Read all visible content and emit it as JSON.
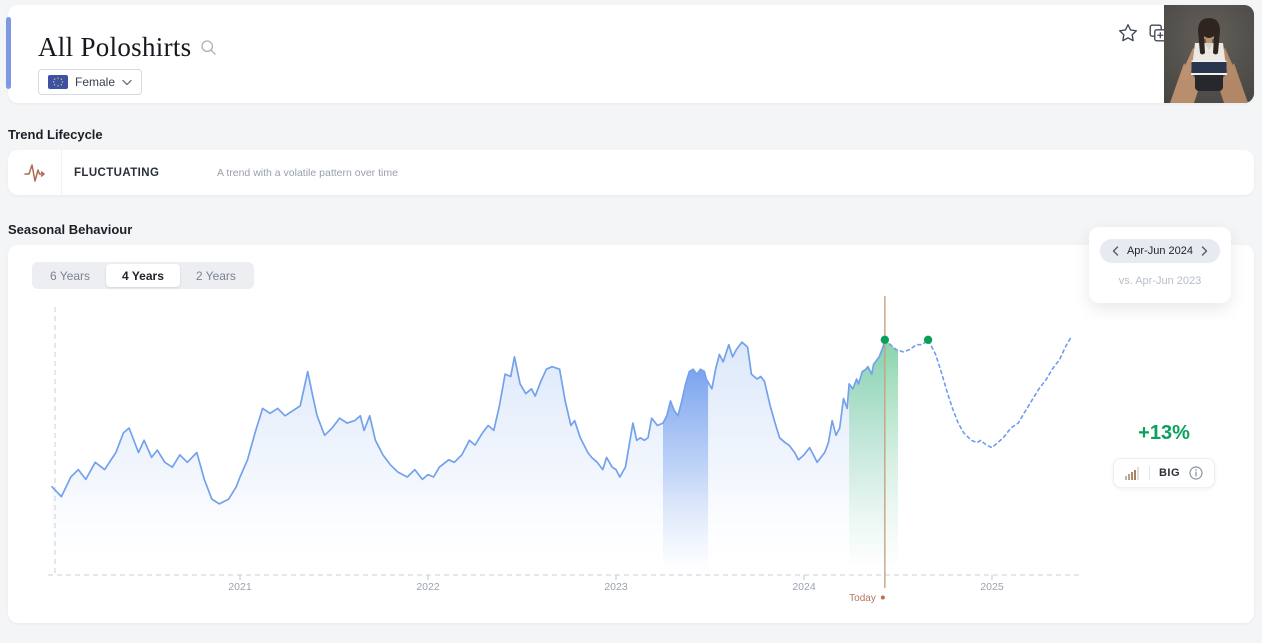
{
  "header": {
    "title": "All Poloshirts",
    "filter": {
      "label": "Female",
      "flag": "eu-flag"
    },
    "icons": {
      "search": "search-icon",
      "favorite": "star-icon",
      "duplicate": "copy-plus-icon"
    }
  },
  "trend_lifecycle": {
    "section_title": "Trend Lifecycle",
    "status": "FLUCTUATING",
    "description": "A trend with a volatile pattern over time",
    "icon": "pulse-icon",
    "icon_color": "#ab6c52"
  },
  "seasonal": {
    "section_title": "Seasonal Behaviour",
    "tabs": [
      {
        "label": "6 Years",
        "selected": false
      },
      {
        "label": "4 Years",
        "selected": true
      },
      {
        "label": "2 Years",
        "selected": false
      }
    ],
    "period_nav": {
      "current": "Apr-Jun 2024",
      "compare": "vs. Apr-Jun 2023"
    },
    "growth": {
      "value": "+13%",
      "magnitude": "BIG",
      "color": "#09a15c",
      "icons": [
        "bar-chart-icon",
        "info-icon"
      ]
    }
  },
  "chart_data": {
    "type": "area",
    "title": "Seasonal Behaviour",
    "xlabel": "",
    "ylabel": "",
    "grid": false,
    "x_axis": {
      "ticks": [
        "2021",
        "2022",
        "2023",
        "2024",
        "2025"
      ],
      "range": [
        2020.0,
        2025.5
      ]
    },
    "ylim": [
      0,
      110
    ],
    "today": {
      "t": 2024.43,
      "label": "Today"
    },
    "highlight_periods": [
      {
        "name": "Apr-Jun 2023",
        "start": 2023.25,
        "end": 2023.49,
        "color": "blue"
      },
      {
        "name": "Apr-Jun 2024",
        "start": 2024.24,
        "end": 2024.5,
        "color": "green"
      }
    ],
    "series": [
      {
        "name": "observed",
        "style": "solid",
        "points": [
          [
            2020.0,
            36
          ],
          [
            2020.05,
            32
          ],
          [
            2020.1,
            40
          ],
          [
            2020.14,
            43
          ],
          [
            2020.18,
            39
          ],
          [
            2020.23,
            46
          ],
          [
            2020.28,
            43
          ],
          [
            2020.34,
            50
          ],
          [
            2020.38,
            58
          ],
          [
            2020.41,
            60
          ],
          [
            2020.46,
            50
          ],
          [
            2020.49,
            55
          ],
          [
            2020.53,
            48
          ],
          [
            2020.56,
            51
          ],
          [
            2020.6,
            46
          ],
          [
            2020.64,
            44
          ],
          [
            2020.68,
            49
          ],
          [
            2020.72,
            46
          ],
          [
            2020.77,
            50
          ],
          [
            2020.81,
            39
          ],
          [
            2020.85,
            31
          ],
          [
            2020.89,
            29
          ],
          [
            2020.94,
            31
          ],
          [
            2020.98,
            36
          ],
          [
            2021.0,
            40
          ],
          [
            2021.04,
            47
          ],
          [
            2021.08,
            58
          ],
          [
            2021.12,
            68
          ],
          [
            2021.16,
            66
          ],
          [
            2021.2,
            68
          ],
          [
            2021.24,
            65
          ],
          [
            2021.28,
            67
          ],
          [
            2021.32,
            69
          ],
          [
            2021.36,
            83
          ],
          [
            2021.39,
            72
          ],
          [
            2021.41,
            65
          ],
          [
            2021.45,
            57
          ],
          [
            2021.49,
            60
          ],
          [
            2021.53,
            64
          ],
          [
            2021.57,
            62
          ],
          [
            2021.61,
            63
          ],
          [
            2021.64,
            65
          ],
          [
            2021.66,
            59
          ],
          [
            2021.69,
            65
          ],
          [
            2021.72,
            55
          ],
          [
            2021.76,
            49
          ],
          [
            2021.8,
            45
          ],
          [
            2021.84,
            42
          ],
          [
            2021.89,
            40
          ],
          [
            2021.93,
            43
          ],
          [
            2021.97,
            39
          ],
          [
            2022.0,
            41
          ],
          [
            2022.03,
            40
          ],
          [
            2022.06,
            44
          ],
          [
            2022.11,
            47
          ],
          [
            2022.14,
            46
          ],
          [
            2022.18,
            49
          ],
          [
            2022.22,
            55
          ],
          [
            2022.25,
            53
          ],
          [
            2022.29,
            58
          ],
          [
            2022.32,
            61
          ],
          [
            2022.35,
            59
          ],
          [
            2022.38,
            69
          ],
          [
            2022.41,
            82
          ],
          [
            2022.44,
            81
          ],
          [
            2022.46,
            89
          ],
          [
            2022.49,
            78
          ],
          [
            2022.52,
            74
          ],
          [
            2022.55,
            76
          ],
          [
            2022.57,
            73
          ],
          [
            2022.6,
            79
          ],
          [
            2022.63,
            84
          ],
          [
            2022.66,
            85
          ],
          [
            2022.7,
            84
          ],
          [
            2022.73,
            71
          ],
          [
            2022.76,
            61
          ],
          [
            2022.78,
            63
          ],
          [
            2022.81,
            56
          ],
          [
            2022.85,
            50
          ],
          [
            2022.87,
            48
          ],
          [
            2022.9,
            46
          ],
          [
            2022.93,
            43
          ],
          [
            2022.95,
            48
          ],
          [
            2022.98,
            44
          ],
          [
            2023.0,
            43
          ],
          [
            2023.02,
            40
          ],
          [
            2023.05,
            44
          ],
          [
            2023.07,
            53
          ],
          [
            2023.09,
            62
          ],
          [
            2023.11,
            55
          ],
          [
            2023.13,
            56
          ],
          [
            2023.15,
            55
          ],
          [
            2023.17,
            56
          ],
          [
            2023.19,
            64
          ],
          [
            2023.22,
            61
          ],
          [
            2023.25,
            62
          ],
          [
            2023.27,
            65
          ],
          [
            2023.29,
            71
          ],
          [
            2023.31,
            67
          ],
          [
            2023.33,
            65
          ],
          [
            2023.35,
            71
          ],
          [
            2023.37,
            78
          ],
          [
            2023.39,
            83
          ],
          [
            2023.41,
            84
          ],
          [
            2023.43,
            82
          ],
          [
            2023.45,
            84
          ],
          [
            2023.47,
            83
          ],
          [
            2023.48,
            80
          ],
          [
            2023.51,
            76
          ],
          [
            2023.53,
            84
          ],
          [
            2023.55,
            90
          ],
          [
            2023.57,
            87
          ],
          [
            2023.6,
            94
          ],
          [
            2023.62,
            89
          ],
          [
            2023.64,
            92
          ],
          [
            2023.67,
            95
          ],
          [
            2023.7,
            93
          ],
          [
            2023.72,
            82
          ],
          [
            2023.75,
            80
          ],
          [
            2023.77,
            81
          ],
          [
            2023.79,
            79
          ],
          [
            2023.82,
            69
          ],
          [
            2023.85,
            61
          ],
          [
            2023.87,
            56
          ],
          [
            2023.9,
            54
          ],
          [
            2023.92,
            53
          ],
          [
            2023.95,
            50
          ],
          [
            2023.97,
            47
          ],
          [
            2024.0,
            49
          ],
          [
            2024.03,
            52
          ],
          [
            2024.05,
            49
          ],
          [
            2024.07,
            46
          ],
          [
            2024.09,
            48
          ],
          [
            2024.11,
            50
          ],
          [
            2024.13,
            54
          ],
          [
            2024.15,
            63
          ],
          [
            2024.17,
            57
          ],
          [
            2024.19,
            60
          ],
          [
            2024.21,
            72
          ],
          [
            2024.23,
            68
          ],
          [
            2024.24,
            78
          ],
          [
            2024.26,
            76
          ],
          [
            2024.28,
            80
          ],
          [
            2024.29,
            78
          ],
          [
            2024.31,
            83
          ],
          [
            2024.33,
            84
          ],
          [
            2024.34,
            85
          ],
          [
            2024.36,
            82
          ],
          [
            2024.37,
            86
          ],
          [
            2024.39,
            88
          ],
          [
            2024.4,
            89
          ],
          [
            2024.42,
            93
          ],
          [
            2024.43,
            96
          ]
        ]
      },
      {
        "name": "forecast",
        "style": "dashed",
        "points": [
          [
            2024.43,
            96
          ],
          [
            2024.46,
            94
          ],
          [
            2024.49,
            92
          ],
          [
            2024.53,
            91
          ],
          [
            2024.56,
            92
          ],
          [
            2024.6,
            94
          ],
          [
            2024.63,
            94
          ],
          [
            2024.66,
            96
          ],
          [
            2024.7,
            90
          ],
          [
            2024.73,
            83
          ],
          [
            2024.76,
            75
          ],
          [
            2024.79,
            68
          ],
          [
            2024.82,
            62
          ],
          [
            2024.85,
            58
          ],
          [
            2024.89,
            55
          ],
          [
            2024.92,
            54
          ],
          [
            2024.94,
            55
          ],
          [
            2024.97,
            53
          ],
          [
            2025.0,
            52
          ],
          [
            2025.03,
            54
          ],
          [
            2025.06,
            56
          ],
          [
            2025.1,
            60
          ],
          [
            2025.14,
            62
          ],
          [
            2025.17,
            66
          ],
          [
            2025.21,
            71
          ],
          [
            2025.25,
            76
          ],
          [
            2025.29,
            80
          ],
          [
            2025.32,
            84
          ],
          [
            2025.36,
            88
          ],
          [
            2025.39,
            93
          ],
          [
            2025.42,
            97
          ]
        ]
      }
    ],
    "markers": [
      {
        "t": 2024.43,
        "v": 96
      },
      {
        "t": 2024.66,
        "v": 96
      }
    ],
    "colors": {
      "line": "#74a1ec",
      "forecast": "#6f9cec",
      "area_top": "#d9e6fa",
      "band_blue": "#6f9bec",
      "band_green": "#79cea2",
      "marker": "#0b9f5c",
      "today_line": "#c9a183",
      "today_text": "#ad7a59",
      "axis": "#c9d1dd",
      "tick_text": "#9aa2b2"
    },
    "legend": []
  }
}
